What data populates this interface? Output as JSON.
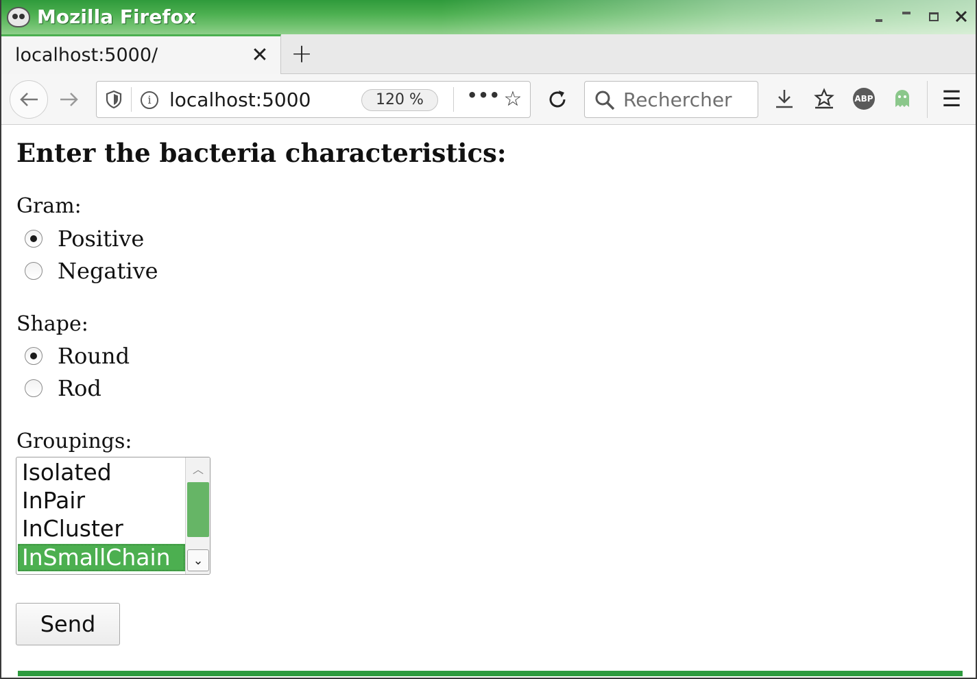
{
  "window": {
    "title": "Mozilla Firefox",
    "icon": "firefox-cat-icon",
    "controls": [
      "minimize-icon",
      "restore-icon",
      "maximize-icon",
      "close-icon"
    ]
  },
  "tabs": [
    {
      "title": "localhost:5000/",
      "close_glyph": "✕"
    }
  ],
  "new_tab_glyph": "+",
  "navbar": {
    "url": "localhost:5000",
    "zoom": "120 %",
    "more_glyph": "•••",
    "bookmark_glyph": "☆",
    "search_placeholder": "Rechercher",
    "abp_label": "ABP",
    "menu_glyph": "☰"
  },
  "page": {
    "heading": "Enter the bacteria characteristics:",
    "gram": {
      "label": "Gram:",
      "options": [
        {
          "label": "Positive",
          "checked": true
        },
        {
          "label": "Negative",
          "checked": false
        }
      ]
    },
    "shape": {
      "label": "Shape:",
      "options": [
        {
          "label": "Round",
          "checked": true
        },
        {
          "label": "Rod",
          "checked": false
        }
      ]
    },
    "groupings": {
      "label": "Groupings:",
      "options": [
        "Isolated",
        "InPair",
        "InCluster",
        "InSmallChain"
      ],
      "selected": "InSmallChain"
    },
    "send_label": "Send"
  },
  "colors": {
    "accent": "#4caf50",
    "titlebar": "#2f9a3b"
  }
}
